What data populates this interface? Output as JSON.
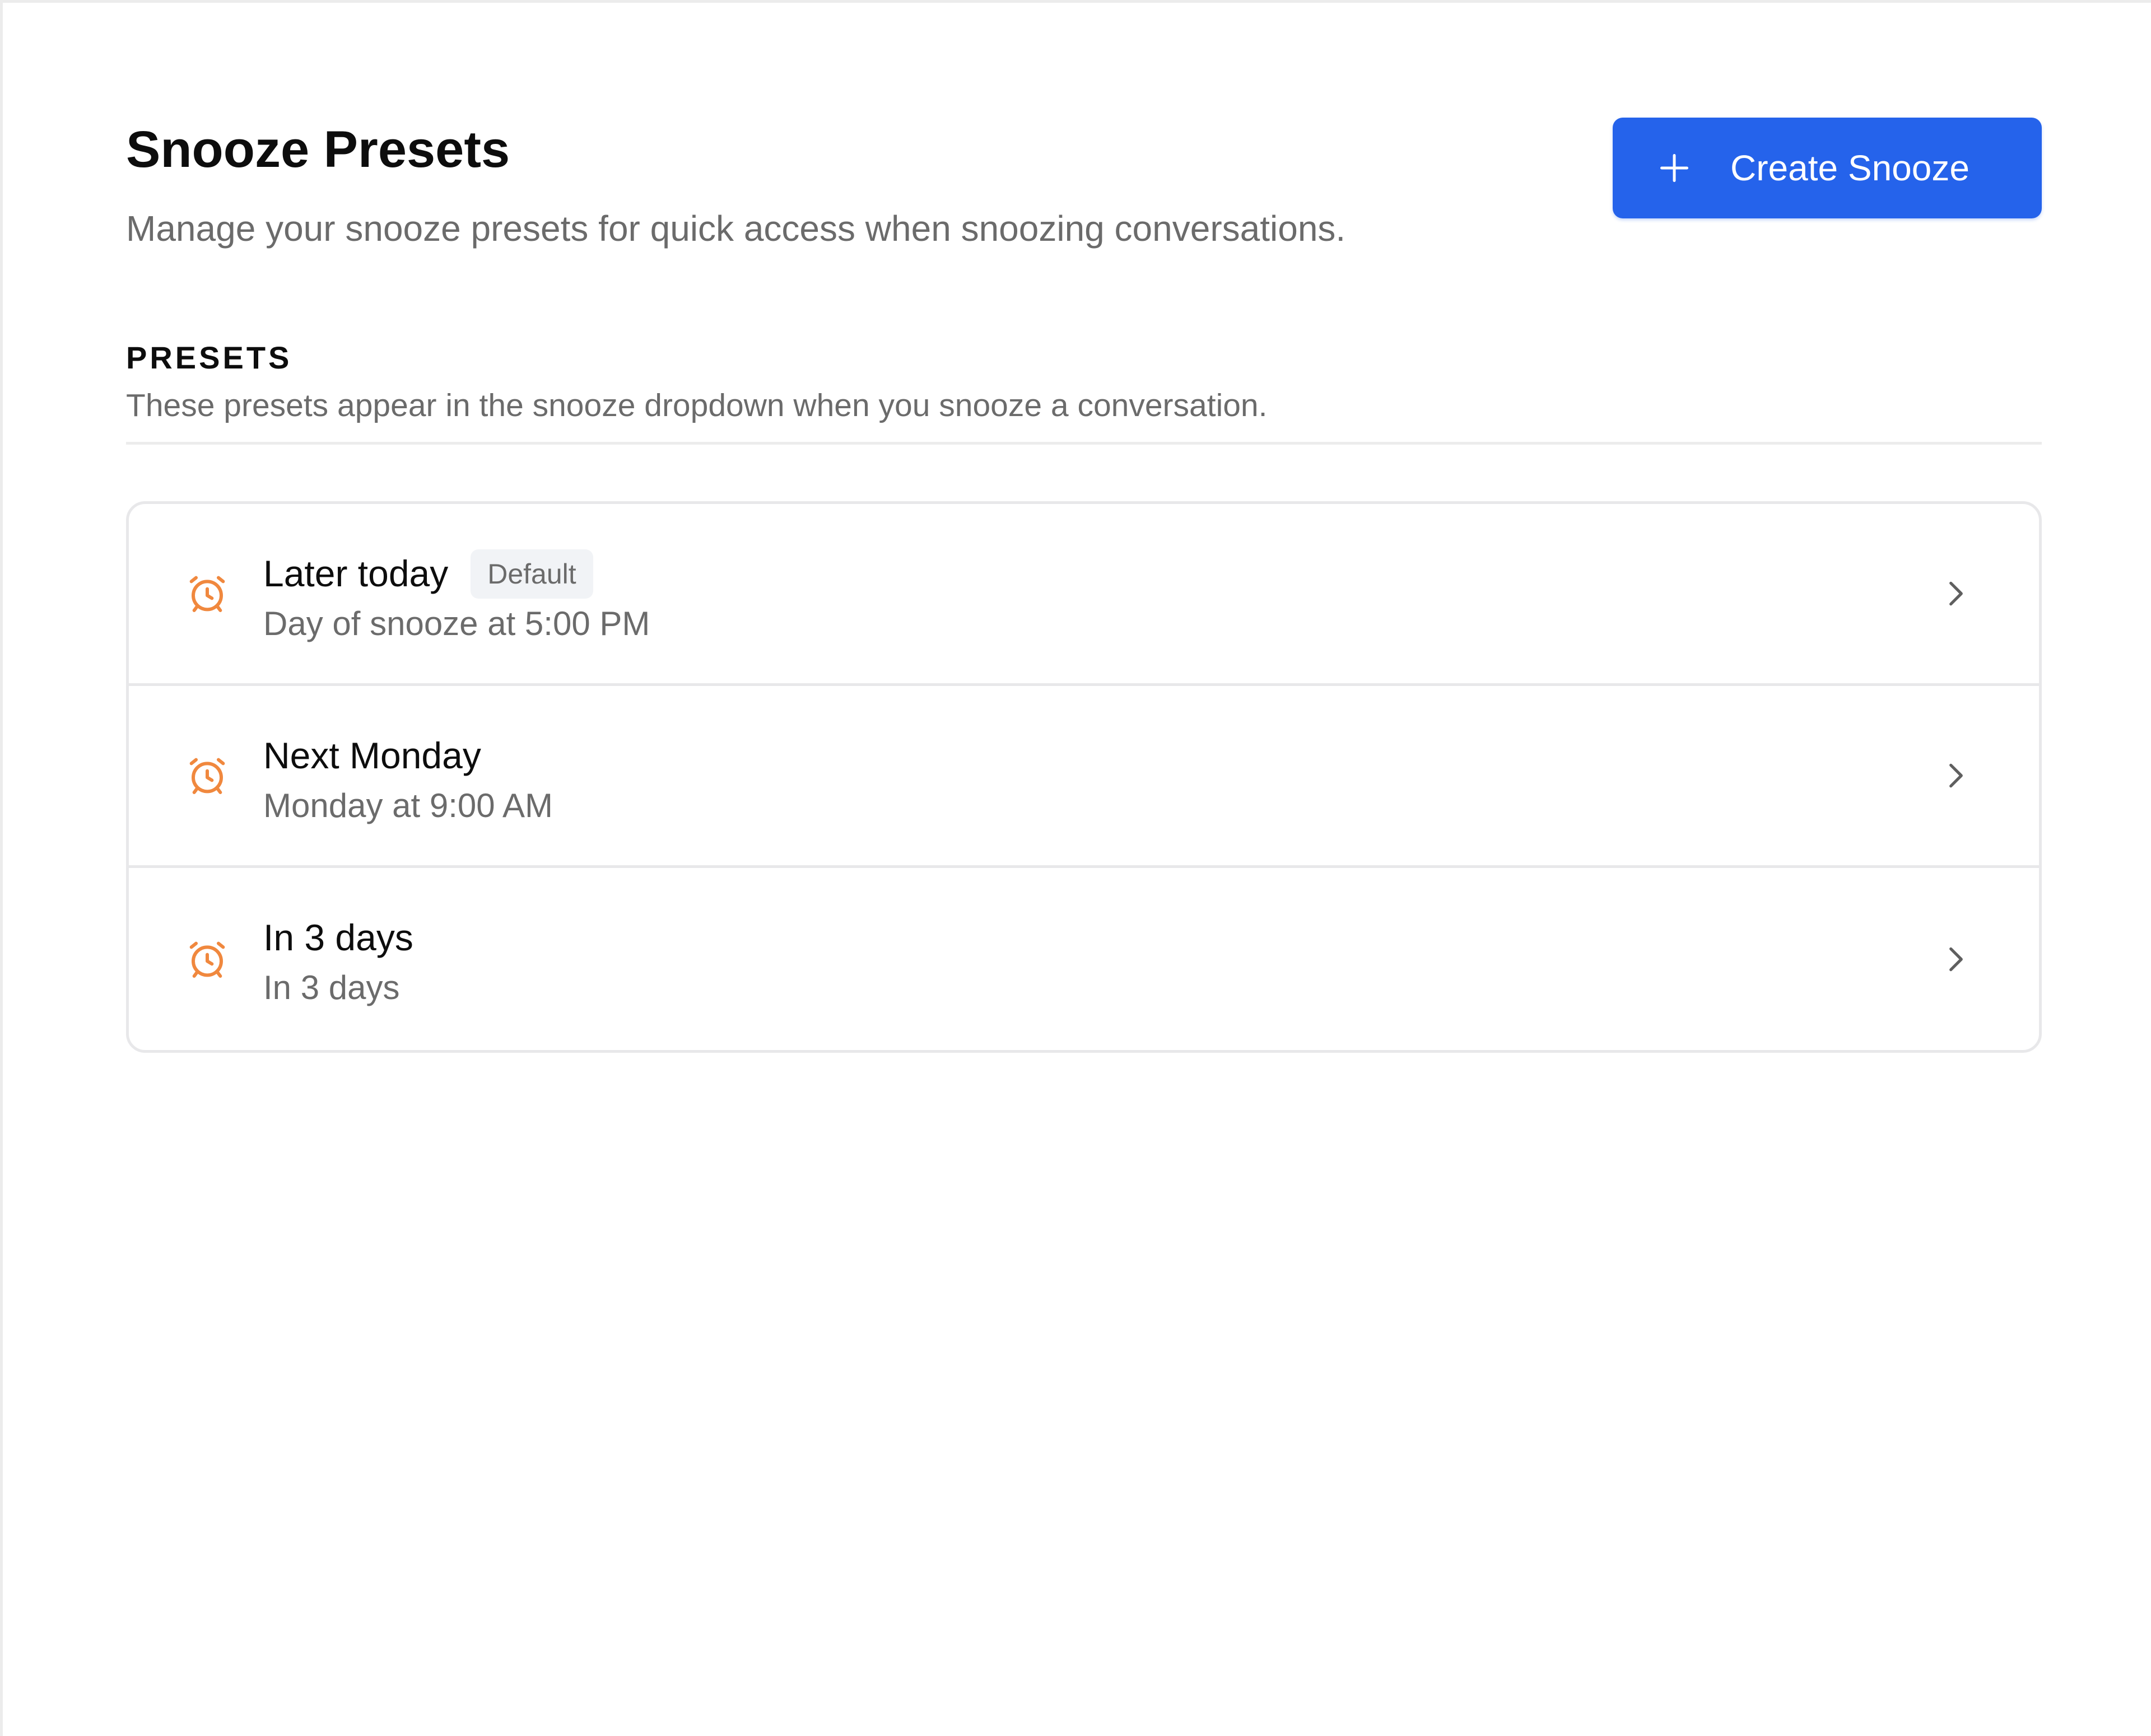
{
  "header": {
    "title": "Snooze Presets",
    "subtitle": "Manage your snooze presets for quick access when snoozing conversations.",
    "create_button_label": "Create Snooze"
  },
  "section": {
    "heading": "PRESETS",
    "description": "These presets appear in the snooze dropdown when you snooze a conversation."
  },
  "presets": [
    {
      "title": "Later today",
      "subtitle": "Day of snooze at 5:00 PM",
      "badge": "Default",
      "icon": "alarm-clock-icon"
    },
    {
      "title": "Next Monday",
      "subtitle": "Monday at 9:00 AM",
      "icon": "alarm-clock-icon"
    },
    {
      "title": "In 3 days",
      "subtitle": "In 3 days",
      "icon": "alarm-clock-icon"
    }
  ],
  "colors": {
    "accent": "#2563eb",
    "icon": "#f0883e"
  }
}
